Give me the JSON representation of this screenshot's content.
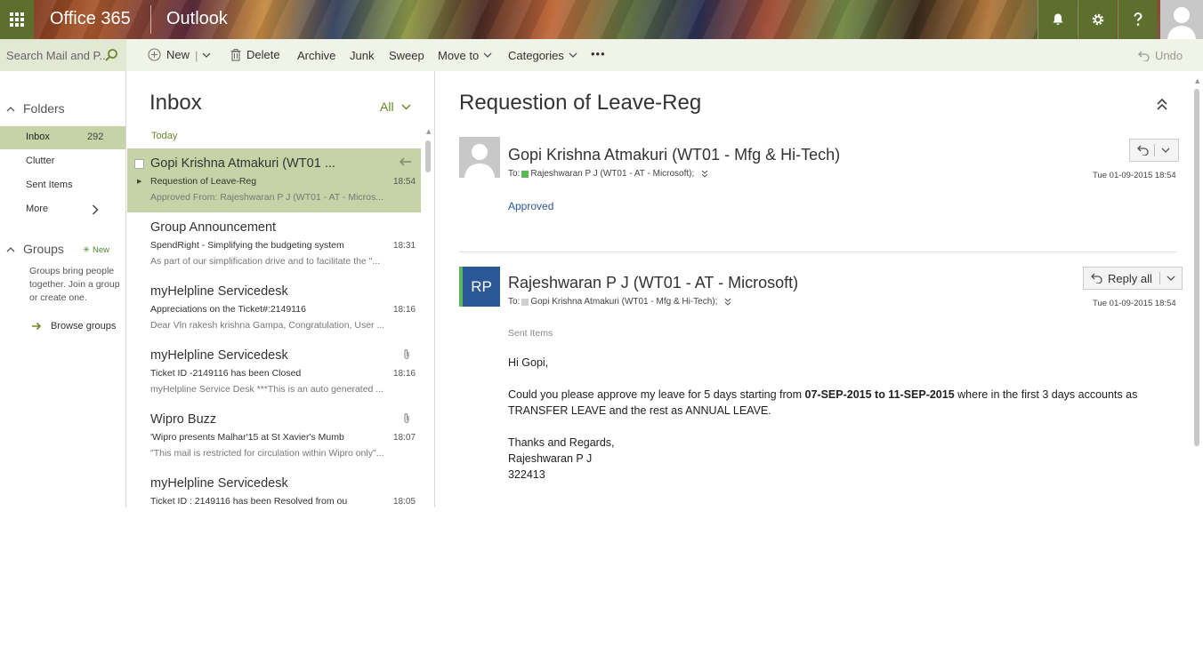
{
  "header": {
    "brand": "Office 365",
    "app_name": "Outlook"
  },
  "toolbar": {
    "search_placeholder": "Search Mail and P...",
    "new_label": "New",
    "delete_label": "Delete",
    "archive_label": "Archive",
    "junk_label": "Junk",
    "sweep_label": "Sweep",
    "move_to_label": "Move to",
    "categories_label": "Categories",
    "more_label": "•••",
    "undo_label": "Undo"
  },
  "folders": {
    "heading": "Folders",
    "items": [
      {
        "label": "Inbox",
        "count": "292"
      },
      {
        "label": "Clutter"
      },
      {
        "label": "Sent Items"
      },
      {
        "label": "More"
      }
    ],
    "groups_heading": "Groups",
    "groups_new": "New",
    "groups_desc": "Groups bring people together. Join a group or create one.",
    "browse_groups": "Browse groups"
  },
  "message_list": {
    "title": "Inbox",
    "filter": "All",
    "day_header": "Today",
    "messages": [
      {
        "from": "Gopi Krishna Atmakuri (WT01 ...",
        "subject": "Requestion of Leave-Reg",
        "preview": "Approved From: Rajeshwaran P J (WT01 - AT - Micros...",
        "time": "18:54"
      },
      {
        "from": "Group Announcement",
        "subject": "SpendRight - Simplifying the budgeting system",
        "preview": "As part of our simplification drive and to facilitate the \"...",
        "time": "18:31"
      },
      {
        "from": "myHelpline Servicedesk",
        "subject": "Appreciations on the Ticket#:2149116",
        "preview": "Dear Vln rakesh krishna Gampa, Congratulation, User ...",
        "time": "18:16"
      },
      {
        "from": "myHelpline Servicedesk",
        "subject": "Ticket ID -2149116 has been Closed",
        "preview": "myHelpline Service Desk ***This is an auto generated ...",
        "time": "18:16"
      },
      {
        "from": "Wipro Buzz",
        "subject": "'Wipro presents Malhar'15 at St Xavier's Mumb",
        "preview": "\"This mail is restricted for circulation within Wipro only\"...",
        "time": "18:07"
      },
      {
        "from": "myHelpline Servicedesk",
        "subject": "Ticket ID : 2149116 has been Resolved from ou",
        "preview": "",
        "time": "18:05"
      }
    ]
  },
  "reading": {
    "title": "Requestion of Leave-Reg",
    "message1": {
      "sender": "Gopi Krishna Atmakuri (WT01 - Mfg & Hi-Tech)",
      "to_label": "To:",
      "to": "Rajeshwaran P J (WT01 - AT - Microsoft);",
      "date": "Tue 01-09-2015 18:54",
      "body": "Approved"
    },
    "message2": {
      "initials": "RP",
      "sender": "Rajeshwaran P J (WT01 - AT - Microsoft)",
      "to_label": "To:",
      "to": "Gopi Krishna Atmakuri (WT01 - Mfg & Hi-Tech);",
      "date": "Tue 01-09-2015 18:54",
      "reply_all": "Reply all",
      "folder": "Sent Items",
      "greeting": "Hi Gopi,",
      "line1_a": "Could you please approve my leave for 5 days starting from ",
      "line1_b": "07-SEP-2015 to 11-SEP-2015",
      "line1_c": " where in the first 3 days accounts as",
      "line2": "TRANSFER LEAVE and the rest as ANNUAL LEAVE.",
      "closing": "Thanks and Regards,",
      "sig_name": "Rajeshwaran P J",
      "sig_id": "322413"
    }
  },
  "colors": {
    "accent_green": "#5c6f2d",
    "selection": "#c5d3a7",
    "avatar_blue": "#2b5797",
    "presence_green": "#5cb85c"
  }
}
